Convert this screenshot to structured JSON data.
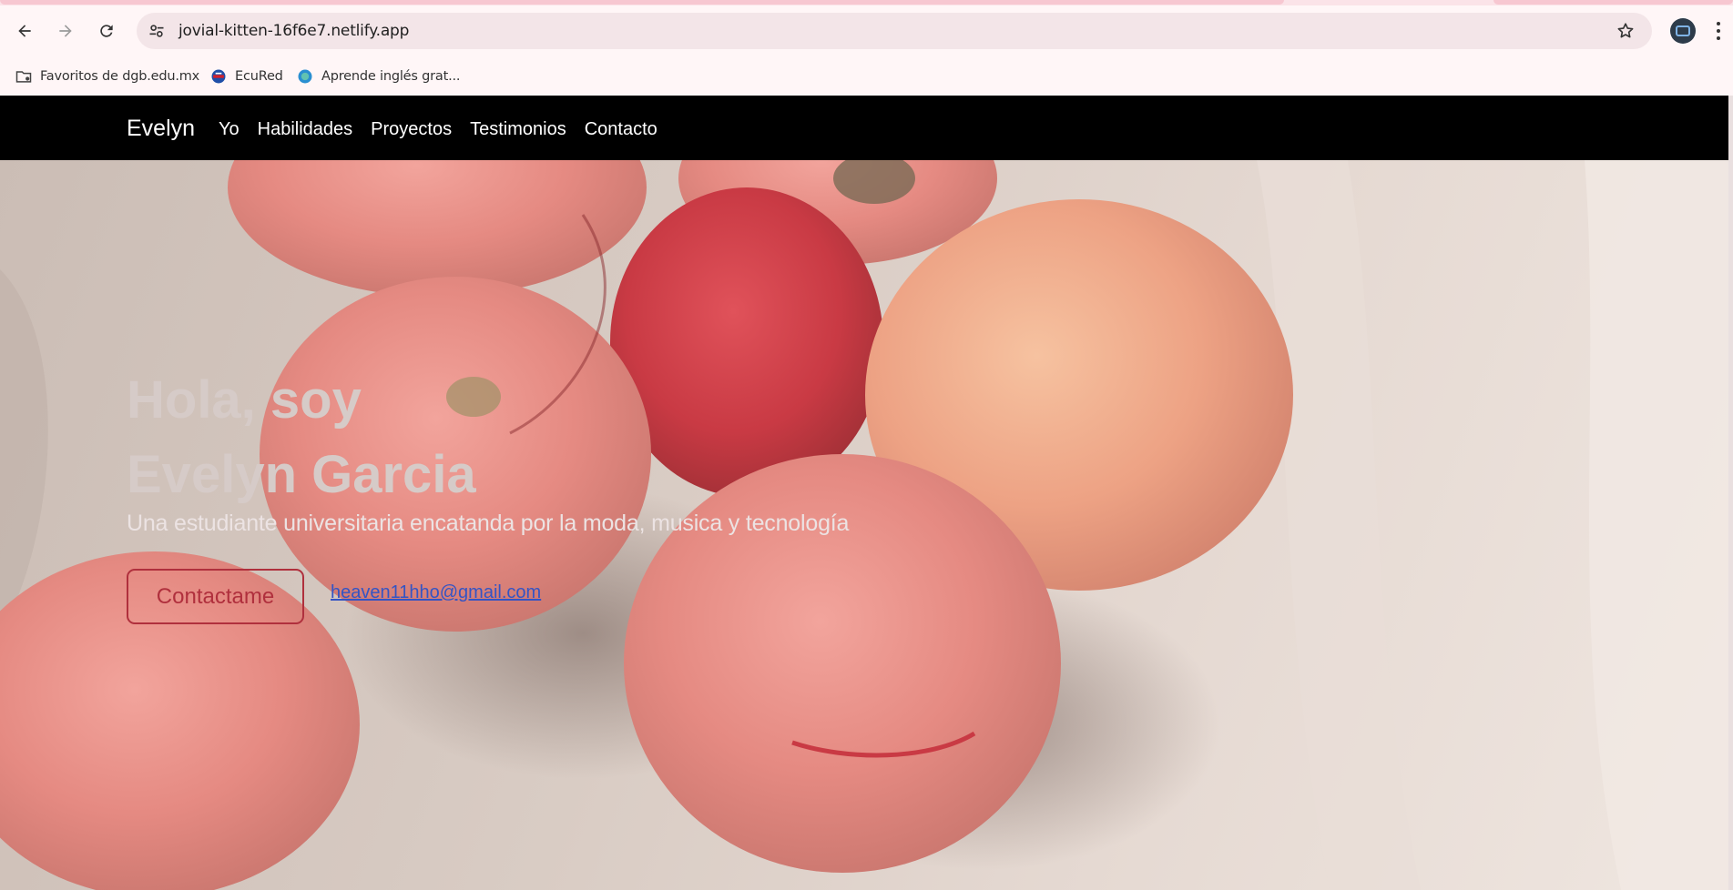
{
  "browser": {
    "url": "jovial-kitten-16f6e7.netlify.app",
    "bookmarks": [
      {
        "label": "Favoritos de dgb.edu.mx",
        "icon": "folder-icon"
      },
      {
        "label": "EcuRed",
        "icon": "ecured-icon"
      },
      {
        "label": "Aprende inglés grat...",
        "icon": "globe-icon"
      }
    ],
    "icons": {
      "back": "arrow-left-icon",
      "forward": "arrow-right-icon",
      "reload": "reload-icon",
      "site_info": "tune-icon",
      "bookmark_star": "star-icon",
      "profile": "avatar",
      "menu": "kebab-icon"
    }
  },
  "navbar": {
    "brand": "Evelyn",
    "links": [
      "Yo",
      "Habilidades",
      "Proyectos",
      "Testimonios",
      "Contacto"
    ]
  },
  "hero": {
    "title_line1": "Hola, soy",
    "title_line2": "Evelyn Garcia",
    "subtitle": "Una estudiante universitaria encatanda por la moda, musica y tecnología",
    "button_label": "Contactame",
    "email": "heaven11hho@gmail.com"
  },
  "colors": {
    "navbar_bg": "#000000",
    "button_accent": "#b0303d",
    "link": "#3454c4",
    "peach": "#e98b83"
  }
}
